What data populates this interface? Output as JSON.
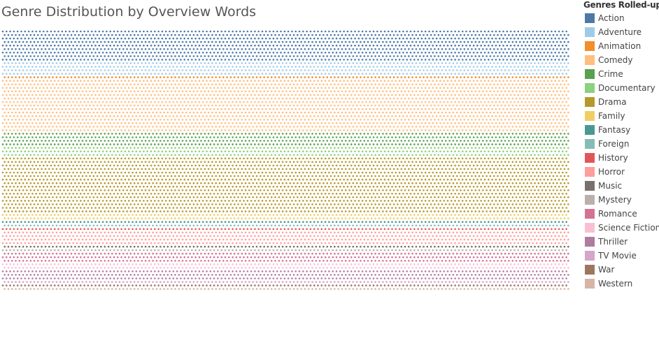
{
  "chart_data": {
    "type": "scatter",
    "title": "Genre Distribution by Overview Words",
    "legend": {
      "title": "Genres Rolled-up",
      "placement": "right"
    },
    "grid": false,
    "series": [
      {
        "name": "Action",
        "color": "#4e79a7",
        "rows": 9
      },
      {
        "name": "Adventure",
        "color": "#a0cbe8",
        "rows": 4
      },
      {
        "name": "Animation",
        "color": "#f28e2b",
        "rows": 1
      },
      {
        "name": "Comedy",
        "color": "#ffbe7d",
        "rows": 15
      },
      {
        "name": "Crime",
        "color": "#59a14f",
        "rows": 4
      },
      {
        "name": "Documentary",
        "color": "#8cd17d",
        "rows": 3
      },
      {
        "name": "Drama",
        "color": "#b6992d",
        "rows": 16
      },
      {
        "name": "Family",
        "color": "#f1ce63",
        "rows": 2
      },
      {
        "name": "Fantasy",
        "color": "#499894",
        "rows": 1
      },
      {
        "name": "Foreign",
        "color": "#86bcb6",
        "rows": 1
      },
      {
        "name": "History",
        "color": "#e15759",
        "rows": 1
      },
      {
        "name": "Horror",
        "color": "#ff9d9a",
        "rows": 4
      },
      {
        "name": "Music",
        "color": "#79706e",
        "rows": 1
      },
      {
        "name": "Mystery",
        "color": "#bab0ac",
        "rows": 1
      },
      {
        "name": "Romance",
        "color": "#d37295",
        "rows": 3
      },
      {
        "name": "Science Fiction",
        "color": "#fabfd2",
        "rows": 2
      },
      {
        "name": "Thriller",
        "color": "#b07aa1",
        "rows": 3
      },
      {
        "name": "TV Movie",
        "color": "#d4a6c8",
        "rows": 1
      },
      {
        "name": "War",
        "color": "#9d7660",
        "rows": 1
      },
      {
        "name": "Western",
        "color": "#d7b5a6",
        "rows": 1
      }
    ]
  }
}
